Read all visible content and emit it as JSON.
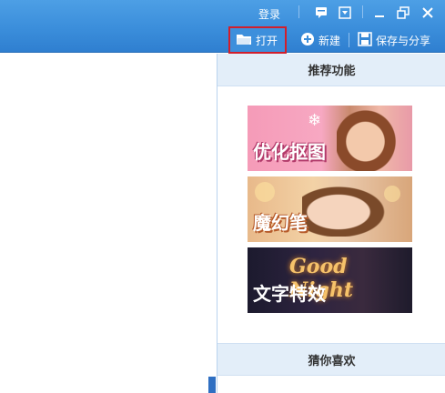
{
  "titlebar": {
    "login": "登录",
    "icons": [
      "message-icon",
      "skin-icon",
      "minimize-icon",
      "maximize-icon",
      "close-icon"
    ]
  },
  "toolbar": {
    "open_label": "打开",
    "new_label": "新建",
    "save_label": "保存与分享"
  },
  "panel": {
    "recommended_title": "推荐功能",
    "features": [
      {
        "label": "优化抠图"
      },
      {
        "label": "魔幻笔"
      },
      {
        "label": "文字特效",
        "overlay": "Good Night"
      }
    ],
    "like_title": "猜你喜欢"
  },
  "colors": {
    "titlebar": "#3b8edb",
    "highlight_border": "#d21e2b",
    "panel_header": "#e3eef9"
  }
}
